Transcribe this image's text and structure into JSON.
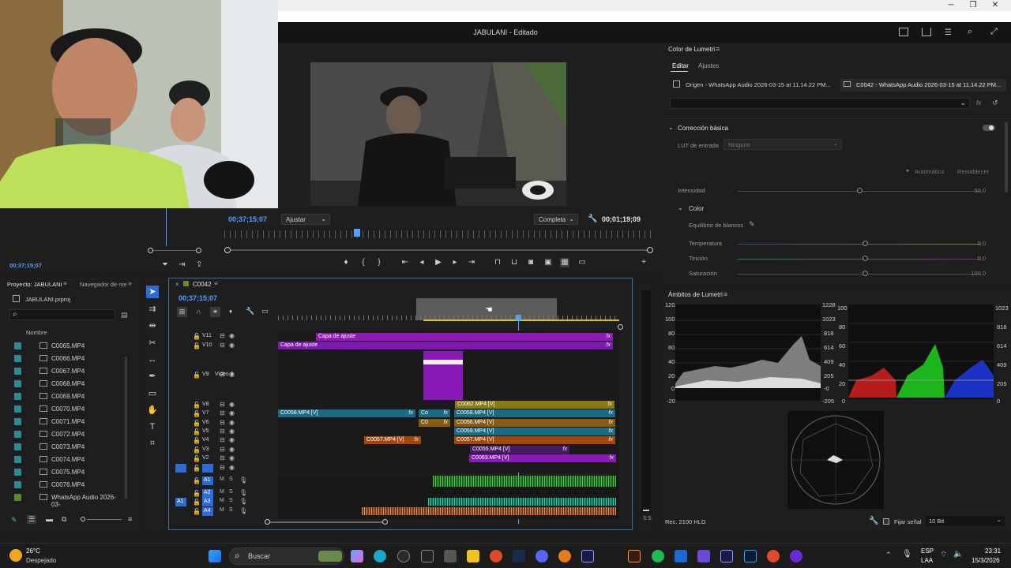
{
  "window": {
    "minimize": "─",
    "maximize": "❐",
    "close": "✕"
  },
  "app": {
    "title": "JABULANI - Editado"
  },
  "program_monitor": {
    "timecode_current": "00;37;15;07",
    "fit_select": "Ajustar",
    "quality_select": "Completa",
    "timecode_duration": "00;01;19;09"
  },
  "source_monitor": {
    "timecode": "00;37;15;07"
  },
  "lumetri_color": {
    "panel_title": "Color de Lumetri",
    "tab_edit": "Editar",
    "tab_settings": "Ajustes",
    "source_origin": "Origen - WhatsApp Audio 2026-03-15 at 11.14.22 PM...",
    "source_clip": "C0042 - WhatsApp Audio 2026-03-15 at 11.14.22 PM...",
    "section_basic": "Corrección básica",
    "lut_label": "LUT de entrada",
    "lut_value": "Ninguno",
    "auto_button": "Automático",
    "reset_button": "Restablecer",
    "intensity_label": "Intensidad",
    "intensity_value": "50,0",
    "intensity_level": 0.5,
    "color_section": "Color",
    "white_balance_label": "Equilibrio de blancos",
    "temperature_label": "Temperatura",
    "temperature_value": "0,0",
    "tint_label": "Tinción",
    "tint_value": "0,0",
    "saturation_label": "Saturación",
    "saturation_value": "100,0"
  },
  "lumetri_scopes": {
    "panel_title": "Ámbitos de Lumetri",
    "waveform_left_ticks": [
      "120",
      "100",
      "80",
      "60",
      "40",
      "20",
      "0",
      "-20"
    ],
    "waveform_right_ticks": [
      "1228",
      "1023",
      "818",
      "614",
      "409",
      "205",
      "-0",
      "-205"
    ],
    "parade_left_ticks": [
      "100",
      "80",
      "60",
      "40",
      "20",
      "0"
    ],
    "parade_right_ticks": [
      "1023",
      "818",
      "614",
      "409",
      "205",
      "0"
    ],
    "color_space": "Rec. 2100 HLG",
    "clamp_label": "Fijar señal",
    "bit_depth": "10 Bit"
  },
  "project": {
    "tab_project": "Proyecto: JABULANI",
    "tab_media": "Navegador de me",
    "file_name": "JABULANI.prproj",
    "column_name": "Nombre",
    "items": [
      "C0065.MP4",
      "C0066.MP4",
      "C0067.MP4",
      "C0068.MP4",
      "C0069.MP4",
      "C0070.MP4",
      "C0071.MP4",
      "C0072.MP4",
      "C0073.MP4",
      "C0074.MP4",
      "C0075.MP4",
      "C0076.MP4",
      "WhatsApp Audio 2026-03-"
    ]
  },
  "timeline": {
    "sequence_name": "C0042",
    "timecode": "00;37;15;07",
    "tracks_video": [
      "V11",
      "V10",
      "V9",
      "V8",
      "V7",
      "V6",
      "V5",
      "V4",
      "V3",
      "V2",
      "V1"
    ],
    "track_v9_name": "Video 9",
    "tracks_audio": [
      "A1",
      "A2",
      "A3",
      "A4"
    ],
    "clips": {
      "adj1": "Capa de ajuste",
      "adj2": "Capa de ajuste",
      "c0062": "C0062.MP4 [V]",
      "c0058a": "C0058.MP4 [V]",
      "co1": "Co",
      "c0058b": "C0058.MP4 [V]",
      "c0056": "C0056.MP4 [V]",
      "co2": "C0",
      "c0059": "C0059.MP4 [V]",
      "c0057a": "C0057.MP4 [V]",
      "c0057b": "C0057.MP4 [V]",
      "c0055": "C0055.MP4 [V]",
      "c0063": "C0063.MP4 [V]"
    },
    "fx": "fx"
  },
  "taskbar": {
    "weather_temp": "26°C",
    "weather_desc": "Despejado",
    "search_placeholder": "Buscar",
    "lang_top": "ESP",
    "lang_bottom": "LAA",
    "time": "23:31",
    "date": "15/3/2026"
  }
}
